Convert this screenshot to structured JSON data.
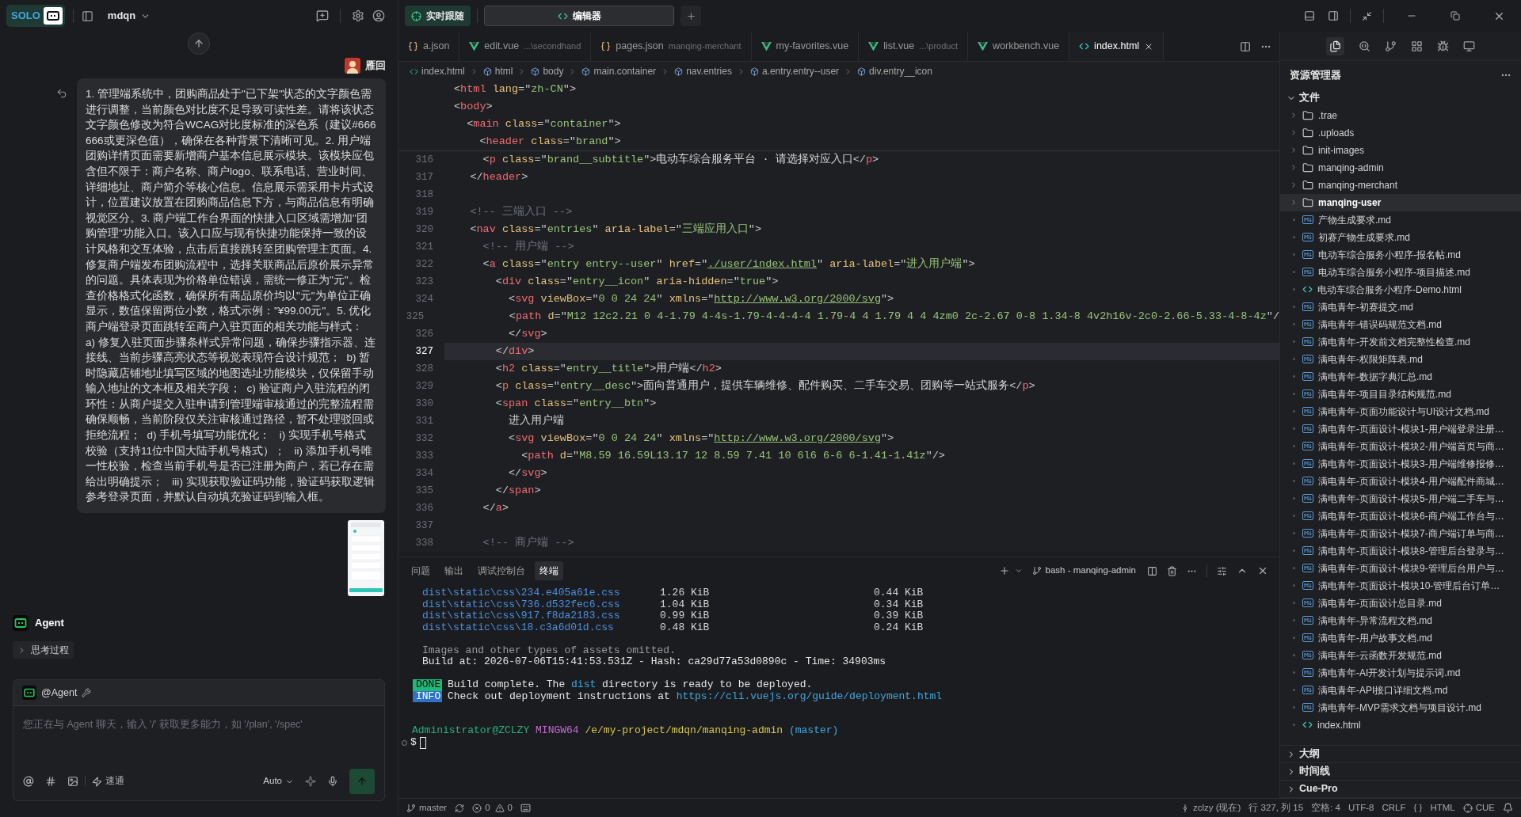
{
  "app": {
    "badge": "SOLO",
    "project": "mdqn"
  },
  "chat": {
    "user": {
      "name": "雁回"
    },
    "message": "1. 管理端系统中，团购商品处于\"已下架\"状态的文字颜色需进行调整，当前颜色对比度不足导致可读性差。请将该状态文字颜色修改为符合WCAG对比度标准的深色系（建议#666666或更深色值），确保在各种背景下清晰可见。2. 用户端团购详情页面需要新增商户基本信息展示模块。该模块应包含但不限于：商户名称、商户logo、联系电话、营业时间、详细地址、商户简介等核心信息。信息展示需采用卡片式设计，位置建议放置在团购商品信息下方，与商品信息有明确视觉区分。3. 商户端工作台界面的快捷入口区域需增加\"团购管理\"功能入口。该入口应与现有快捷功能保持一致的设计风格和交互体验，点击后直接跳转至团购管理主页面。4. 修复商户端发布团购流程中，选择关联商品后原价展示异常的问题。具体表现为价格单位错误，需统一修正为\"元\"。检查价格格式化函数，确保所有商品原价均以\"元\"为单位正确显示，数值保留两位小数，格式示例：\"¥99.00元\"。5. 优化商户端登录页面跳转至商户入驻页面的相关功能与样式：  a) 修复入驻页面步骤条样式异常问题，确保步骤指示器、连接线、当前步骤高亮状态等视觉表现符合设计规范；  b) 暂时隐藏店铺地址填写区域的地图选址功能模块，仅保留手动输入地址的文本框及相关字段；  c) 验证商户入驻流程的闭环性：从商户提交入驻申请到管理端审核通过的完整流程需确保顺畅，当前阶段仅关注审核通过路径，暂不处理驳回或拒绝流程；  d) 手机号填写功能优化：   i) 实现手机号格式校验（支持11位中国大陆手机号格式）；   ii) 添加手机号唯一性校验，检查当前手机号是否已注册为商户，若已存在需给出明确提示；   iii) 实现获取验证码功能，验证码获取逻辑参考登录页面，并默认自动填充验证码到输入框。",
    "agent": {
      "name": "Agent"
    },
    "thinking": {
      "label": "思考过程",
      "expanded": false
    },
    "composer": {
      "mention": "@Agent",
      "placeholder": "您正在与 Agent 聊天，输入 '/' 获取更多能力，如 '/plan', '/spec'",
      "speed": "速通",
      "model": "Auto"
    }
  },
  "top_bar": {
    "follow_button": "实时跟随",
    "tabs": [
      {
        "label": "编辑器",
        "selected": true
      }
    ]
  },
  "editor_tabs": [
    {
      "name": "a.json",
      "kind": "json",
      "selected": false
    },
    {
      "name": "edit.vue",
      "path": "...\\secondhand",
      "kind": "vue",
      "selected": false
    },
    {
      "name": "pages.json",
      "path": "manqing-merchant",
      "kind": "json",
      "selected": false
    },
    {
      "name": "my-favorites.vue",
      "kind": "vue",
      "selected": false
    },
    {
      "name": "list.vue",
      "path": "...\\product",
      "kind": "vue",
      "selected": false
    },
    {
      "name": "workbench.vue",
      "kind": "vue",
      "selected": false
    },
    {
      "name": "index.html",
      "kind": "html",
      "selected": true
    }
  ],
  "breadcrumb": [
    {
      "label": "index.html",
      "kind": "file"
    },
    {
      "label": "html",
      "kind": "element"
    },
    {
      "label": "body",
      "kind": "element"
    },
    {
      "label": "main.container",
      "kind": "element"
    },
    {
      "label": "nav.entries",
      "kind": "element"
    },
    {
      "label": "a.entry.entry--user",
      "kind": "element"
    },
    {
      "label": "div.entry__icon",
      "kind": "element"
    }
  ],
  "sticky_lines": [
    "<html lang=\"zh-CN\">",
    "<body>",
    "  <main class=\"container\">",
    "    <header class=\"brand\">"
  ],
  "code_lines": [
    {
      "number": "316",
      "text": "      <p class=\"brand__subtitle\">电动车综合服务平台 · 请选择对应入口</p>",
      "current": false
    },
    {
      "number": "317",
      "text": "    </header>",
      "current": false
    },
    {
      "number": "318",
      "current": false
    },
    {
      "number": "319",
      "text": "    <!-- 三端入口 -->",
      "current": false
    },
    {
      "number": "320",
      "text": "    <nav class=\"entries\" aria-label=\"三端应用入口\">",
      "current": false
    },
    {
      "number": "321",
      "text": "      <!-- 用户端 -->",
      "current": false
    },
    {
      "number": "322",
      "text": "      <a class=\"entry entry--user\" href=\"./user/index.html\" aria-label=\"进入用户端\">",
      "current": false
    },
    {
      "number": "323",
      "text": "        <div class=\"entry__icon\" aria-hidden=\"true\">",
      "current": false
    },
    {
      "number": "324",
      "text": "          <svg viewBox=\"0 0 24 24\" xmlns=\"http://www.w3.org/2000/svg\">",
      "current": false
    },
    {
      "number": "325",
      "text": "            <path d=\"M12 12c2.21 0 4-1.79 4-4s-1.79-4-4-4-4 1.79-4 4 1.79 4 4 4zm0 2c-2.67 0-8 1.34-8 4v2h16v-2c0-2.66-5.33-4-8-4z\"/",
      "current": false
    },
    {
      "number": "326",
      "text": "          </svg>",
      "current": false
    },
    {
      "number": "327",
      "text": "        </div>",
      "current": true
    },
    {
      "number": "328",
      "text": "        <h2 class=\"entry__title\">用户端</h2>",
      "current": false
    },
    {
      "number": "329",
      "text": "        <p class=\"entry__desc\">面向普通用户，提供车辆维修、配件购买、二手车交易、团购等一站式服务</p>",
      "current": false
    },
    {
      "number": "330",
      "text": "        <span class=\"entry__btn\">",
      "current": false
    },
    {
      "number": "331",
      "text": "          进入用户端",
      "current": false
    },
    {
      "number": "332",
      "text": "          <svg viewBox=\"0 0 24 24\" xmlns=\"http://www.w3.org/2000/svg\">",
      "current": false
    },
    {
      "number": "333",
      "text": "            <path d=\"M8.59 16.59L13.17 12 8.59 7.41 10 6l6 6-6 6-1.41-1.41z\"/>",
      "current": false
    },
    {
      "number": "334",
      "text": "          </svg>",
      "current": false
    },
    {
      "number": "335",
      "text": "        </span>",
      "current": false
    },
    {
      "number": "336",
      "text": "      </a>",
      "current": false
    },
    {
      "number": "337",
      "current": false
    },
    {
      "number": "338",
      "text": "      <!-- 商户端 -->",
      "current": false
    }
  ],
  "panel_tabs": [
    {
      "label": "问题",
      "selected": false
    },
    {
      "label": "输出",
      "selected": false
    },
    {
      "label": "调试控制台",
      "selected": false
    },
    {
      "label": "终端",
      "selected": true
    }
  ],
  "terminal": {
    "name": "bash - manqing-admin",
    "lines": [
      {
        "kind": "asset",
        "file": "dist\\static\\css\\234.e405a61e.css",
        "size": "1.26 KiB",
        "gzip": "0.44 KiB"
      },
      {
        "kind": "asset",
        "file": "dist\\static\\css\\736.d532fec6.css",
        "size": "1.04 KiB",
        "gzip": "0.34 KiB"
      },
      {
        "kind": "asset",
        "file": "dist\\static\\css\\917.f8da2183.css",
        "size": "0.99 KiB",
        "gzip": "0.39 KiB"
      },
      {
        "kind": "asset",
        "file": "dist\\static\\css\\18.c3a6d01d.css",
        "size": "0.48 KiB",
        "gzip": "0.24 KiB"
      },
      {
        "kind": "blank"
      },
      {
        "kind": "note",
        "text": "Images and other types of assets omitted."
      },
      {
        "kind": "plain",
        "text": "Build at: 2026-07-06T15:41:53.531Z - Hash: ca29d77a53d0890c - Time: 34903ms"
      },
      {
        "kind": "blank"
      },
      {
        "kind": "done",
        "badge": "DONE",
        "parts": [
          {
            "text": "Build complete. The ",
            "link": false
          },
          {
            "text": "dist",
            "link": true
          },
          {
            "text": " directory is ready to be deployed.",
            "link": false
          }
        ]
      },
      {
        "kind": "info",
        "badge": "INFO",
        "parts": [
          {
            "text": "Check out deployment instructions at ",
            "link": false
          },
          {
            "text": "https://cli.vuejs.org/guide/deployment.html",
            "link": true
          }
        ]
      },
      {
        "kind": "blank"
      },
      {
        "kind": "blank"
      },
      {
        "kind": "prompt",
        "user": "Administrator@ZCLZY",
        "shell": "MINGW64",
        "path": "/e/my-project/mdqn/manqing-admin",
        "branch": "(master)"
      },
      {
        "kind": "input",
        "text": "$"
      }
    ]
  },
  "explorer": {
    "title": "资源管理器",
    "section": "文件",
    "expanded": true,
    "items": [
      {
        "name": ".trae",
        "kind": "folder",
        "selected": false
      },
      {
        "name": ".uploads",
        "kind": "folder",
        "selected": false
      },
      {
        "name": "init-images",
        "kind": "folder",
        "selected": false
      },
      {
        "name": "manqing-admin",
        "kind": "folder",
        "selected": false
      },
      {
        "name": "manqing-merchant",
        "kind": "folder",
        "selected": false
      },
      {
        "name": "manqing-user",
        "kind": "folder",
        "selected": true
      },
      {
        "name": "产物生成要求.md",
        "kind": "md",
        "selected": false
      },
      {
        "name": "初赛产物生成要求.md",
        "kind": "md",
        "selected": false
      },
      {
        "name": "电动车综合服务小程序-报名帖.md",
        "kind": "md",
        "selected": false
      },
      {
        "name": "电动车综合服务小程序-项目描述.md",
        "kind": "md",
        "selected": false
      },
      {
        "name": "电动车综合服务小程序-Demo.html",
        "kind": "html",
        "selected": false
      },
      {
        "name": "满电青年-初赛提交.md",
        "kind": "md",
        "selected": false
      },
      {
        "name": "满电青年-错误码规范文档.md",
        "kind": "md",
        "selected": false
      },
      {
        "name": "满电青年-开发前文档完整性检查.md",
        "kind": "md",
        "selected": false
      },
      {
        "name": "满电青年-权限矩阵表.md",
        "kind": "md",
        "selected": false
      },
      {
        "name": "满电青年-数据字典汇总.md",
        "kind": "md",
        "selected": false
      },
      {
        "name": "满电青年-项目目录结构规范.md",
        "kind": "md",
        "selected": false
      },
      {
        "name": "满电青年-页面功能设计与UI设计文档.md",
        "kind": "md",
        "selected": false
      },
      {
        "name": "满电青年-页面设计-模块1-用户端登录注册…",
        "kind": "md",
        "selected": false
      },
      {
        "name": "满电青年-页面设计-模块2-用户端首页与商…",
        "kind": "md",
        "selected": false
      },
      {
        "name": "满电青年-页面设计-模块3-用户端维修报修…",
        "kind": "md",
        "selected": false
      },
      {
        "name": "满电青年-页面设计-模块4-用户端配件商城…",
        "kind": "md",
        "selected": false
      },
      {
        "name": "满电青年-页面设计-模块5-用户端二手车与…",
        "kind": "md",
        "selected": false
      },
      {
        "name": "满电青年-页面设计-模块6-商户端工作台与…",
        "kind": "md",
        "selected": false
      },
      {
        "name": "满电青年-页面设计-模块7-商户端订单与商…",
        "kind": "md",
        "selected": false
      },
      {
        "name": "满电青年-页面设计-模块8-管理后台登录与…",
        "kind": "md",
        "selected": false
      },
      {
        "name": "满电青年-页面设计-模块9-管理后台用户与…",
        "kind": "md",
        "selected": false
      },
      {
        "name": "满电青年-页面设计-模块10-管理后台订单…",
        "kind": "md",
        "selected": false
      },
      {
        "name": "满电青年-页面设计总目录.md",
        "kind": "md",
        "selected": false
      },
      {
        "name": "满电青年-异常流程文档.md",
        "kind": "md",
        "selected": false
      },
      {
        "name": "满电青年-用户故事文档.md",
        "kind": "md",
        "selected": false
      },
      {
        "name": "满电青年-云函数开发规范.md",
        "kind": "md",
        "selected": false
      },
      {
        "name": "满电青年-AI开发计划与提示词.md",
        "kind": "md",
        "selected": false
      },
      {
        "name": "满电青年-API接口详细文档.md",
        "kind": "md",
        "selected": false
      },
      {
        "name": "满电青年-MVP需求文档与项目设计.md",
        "kind": "md",
        "selected": false
      },
      {
        "name": "index.html",
        "kind": "html",
        "selected": false
      }
    ],
    "sections": [
      {
        "label": "大纲",
        "expanded": false
      },
      {
        "label": "时间线",
        "expanded": false
      },
      {
        "label": "Cue-Pro",
        "expanded": false
      }
    ]
  },
  "status_bar": {
    "branch": "master",
    "errors": "0",
    "warnings": "0",
    "author": "zclzy (现在)",
    "position": "行 327, 列 15",
    "spaces": "空格: 4",
    "encoding": "UTF-8",
    "eol": "CRLF",
    "braces": "{ }",
    "language": "HTML",
    "cue": "CUE"
  }
}
